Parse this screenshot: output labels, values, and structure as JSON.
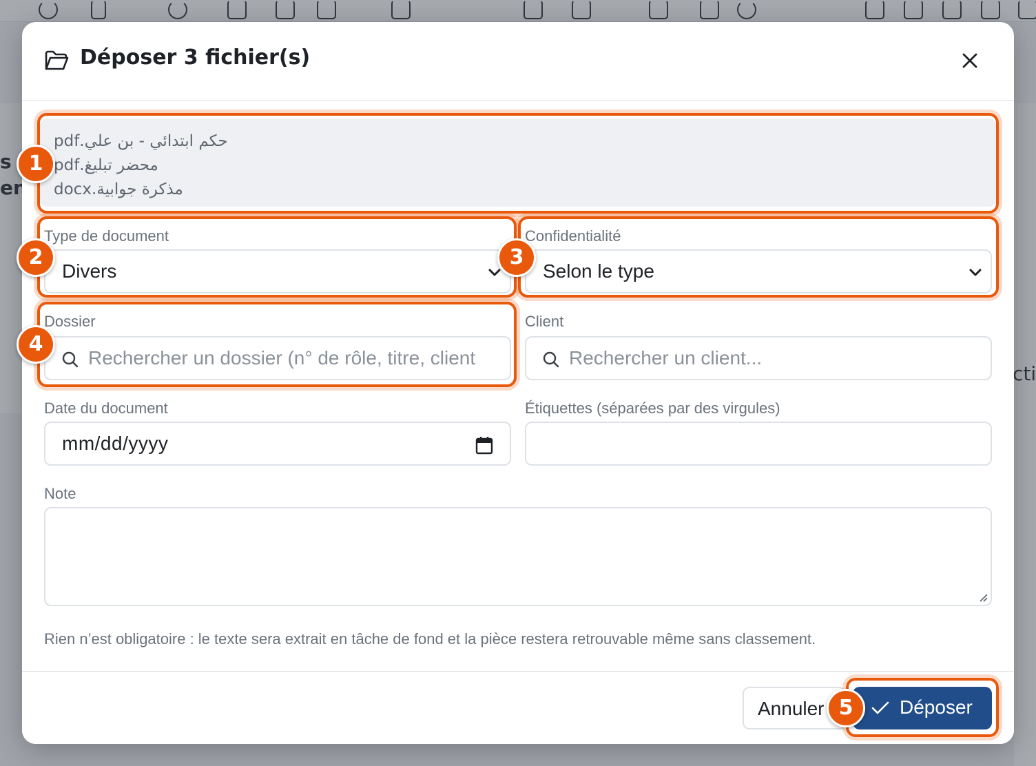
{
  "modal": {
    "title": "Déposer 3 fichier(s)",
    "files": [
      "حكم ابتدائي - بن علي.pdf",
      "محضر تبليغ.pdf",
      "مذكرة جوابية.docx"
    ]
  },
  "form": {
    "doc_type_label": "Type de document",
    "doc_type_value": "Divers",
    "confidentiality_label": "Confidentialité",
    "confidentiality_value": "Selon le type",
    "dossier_label": "Dossier",
    "dossier_placeholder": "Rechercher un dossier (n° de rôle, titre, client",
    "client_label": "Client",
    "client_placeholder": "Rechercher un client...",
    "date_label": "Date du document",
    "date_value": "mm/dd/yyyy",
    "tags_label": "Étiquettes (séparées par des virgules)",
    "note_label": "Note",
    "help_text": "Rien n’est obligatoire : le texte sera extrait en tâche de fond et la pièce restera retrouvable même sans classement."
  },
  "footer": {
    "cancel_label": "Annuler",
    "submit_label": "Déposer"
  },
  "annotations": [
    "1",
    "2",
    "3",
    "4",
    "5"
  ],
  "colors": {
    "accent": "#e8590c",
    "primary": "#214e8a"
  },
  "background": {
    "text_1": "s",
    "text_2": "ent",
    "text_3": "ctio"
  }
}
